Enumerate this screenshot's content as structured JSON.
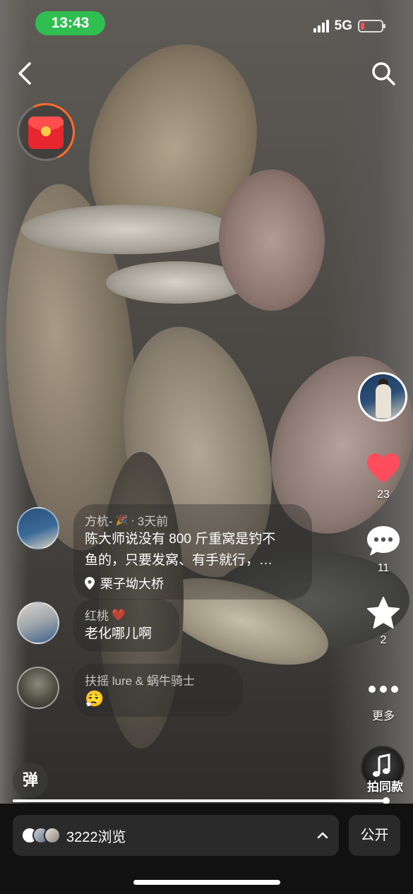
{
  "status_bar": {
    "time": "13:43",
    "network": "5G",
    "colors": {
      "time_pill": "#2fbf51",
      "battery_low": "#ff4d4d"
    }
  },
  "nav": {
    "back_icon": "chevron-left-icon",
    "search_icon": "search-icon",
    "red_packet_icon": "red-envelope-icon"
  },
  "rail": {
    "like_count": "23",
    "comment_count": "11",
    "favorite_count": "2",
    "more_label": "更多",
    "music_label": "拍同款",
    "colors": {
      "like": "#ff4d5e"
    }
  },
  "comments": [
    {
      "author": "方杭-",
      "author_emoji": "🎉",
      "time": "3天前",
      "line1": "陈大师说没有 800 斤重窝是钓不",
      "line2": "鱼的，只要发窝、有手就行，…",
      "location": "栗子坳大桥"
    },
    {
      "author": "红桃",
      "author_emoji": "❤️",
      "text": "老化哪儿啊"
    },
    {
      "author": "扶摇 lure & 蜗牛骑士",
      "text": "😮‍💨"
    }
  ],
  "danmu_label": "弹",
  "progress": {
    "played_fraction": 0.995
  },
  "bottom": {
    "views": "3222浏览",
    "public_label": "公开"
  }
}
